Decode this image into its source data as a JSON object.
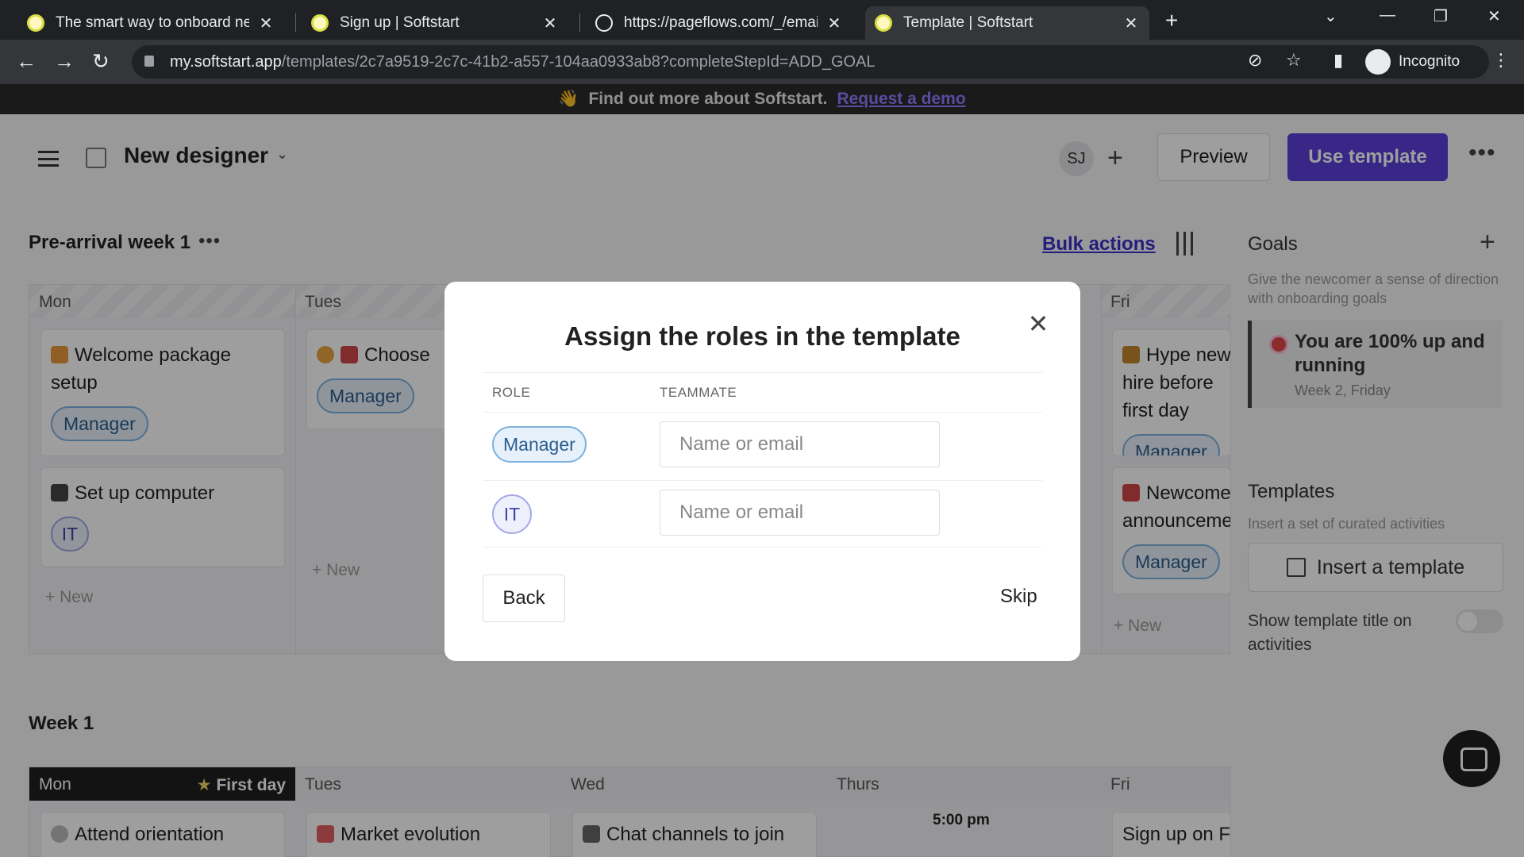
{
  "browser": {
    "tabs": [
      {
        "title": "The smart way to onboard new h"
      },
      {
        "title": "Sign up | Softstart"
      },
      {
        "title": "https://pageflows.com/_/emails/_"
      },
      {
        "title": "Template | Softstart"
      }
    ],
    "url_host": "my.softstart.app",
    "url_path": "/templates/2c7a9519-2c7c-41b2-a557-104aa0933ab8?completeStepId=ADD_GOAL",
    "profile_label": "Incognito"
  },
  "banner": {
    "text": "Find out more about Softstart.",
    "link": "Request a demo"
  },
  "header": {
    "title": "New designer",
    "avatar_initials": "SJ",
    "preview_label": "Preview",
    "use_label": "Use template",
    "accent": "#5b3fd9"
  },
  "prearrival": {
    "title": "Pre-arrival week 1",
    "bulk_label": "Bulk actions",
    "days": [
      "Mon",
      "Tues",
      "Fri"
    ],
    "cards": {
      "mon1": {
        "title": "Welcome package setup",
        "role": "Manager"
      },
      "mon2": {
        "title": "Set up computer",
        "role": "IT"
      },
      "tue1": {
        "title": "Choose",
        "role": "Manager"
      },
      "fri1": {
        "title": "Hype new hire before first day",
        "role": "Manager"
      },
      "fri2": {
        "title": "Newcomer announcement",
        "role": "Manager"
      }
    },
    "new_label": "New"
  },
  "goals": {
    "title": "Goals",
    "desc": "Give the newcomer a sense of direction with onboarding goals",
    "goal_title": "You are 100% up and running",
    "goal_sub": "Week 2, Friday"
  },
  "templates": {
    "title": "Templates",
    "desc": "Insert a set of curated activities",
    "insert_label": "Insert a template",
    "show_title_label": "Show template title on activities"
  },
  "week1": {
    "title": "Week 1",
    "days": [
      "Mon",
      "Tues",
      "Wed",
      "Thurs",
      "Fri"
    ],
    "first_day_label": "First day",
    "time": "5:00 pm",
    "cards": [
      "Attend orientation",
      "Market evolution",
      "Chat channels to join",
      "Sign up on F"
    ]
  },
  "modal": {
    "title": "Assign the roles in the template",
    "col_role": "ROLE",
    "col_teammate": "TEAMMATE",
    "rows": [
      {
        "role": "Manager",
        "placeholder": "Name or email"
      },
      {
        "role": "IT",
        "placeholder": "Name or email"
      }
    ],
    "back_label": "Back",
    "skip_label": "Skip"
  }
}
